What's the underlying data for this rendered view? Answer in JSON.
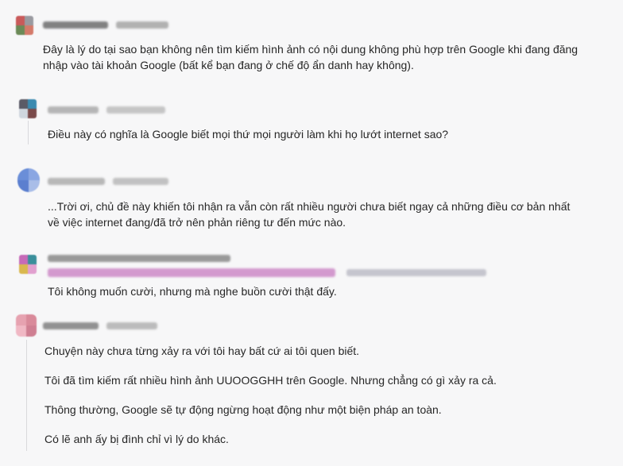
{
  "comments": [
    {
      "author": "",
      "time": "",
      "text": "Đây là lý do tại sao bạn không nên tìm kiếm hình ảnh có nội dung không phù hợp trên Google khi đang đăng nhập vào tài khoản Google (bất kể bạn đang ở chế độ ẩn danh hay không).",
      "avatar_colors": [
        "#c95a5a",
        "#9a9aa0",
        "#6b8a57",
        "#d47a6a"
      ]
    },
    {
      "author": "",
      "time": "",
      "text": "Điều này có nghĩa là Google biết mọi thứ mọi người làm khi họ lướt internet sao?",
      "avatar_colors": [
        "#5a5a66",
        "#3a8ab0",
        "#cfd6de",
        "#7a4a4a"
      ]
    },
    {
      "author": "",
      "time": "",
      "text": "...Trời ơi, chủ đề này khiến tôi nhận ra vẫn còn rất nhiều người chưa biết ngay cả những điều cơ bản nhất về việc internet đang/đã trở nên phản riêng tư đến mức nào.",
      "avatar_colors": [
        "#6a8ed8",
        "#8aa6e2",
        "#5b7fcf",
        "#a9bde8"
      ]
    },
    {
      "author": "",
      "time": "",
      "text": "Tôi không muốn cười, nhưng mà nghe buồn cười thật đấy.",
      "avatar_colors": [
        "#c66ab8",
        "#3a8f9b",
        "#d9b84e",
        "#e1a0cf"
      ]
    },
    {
      "author": "",
      "time": "",
      "paragraphs": [
        "Chuyện này chưa từng xảy ra với tôi hay bất cứ ai tôi quen biết.",
        "Tôi đã tìm kiếm rất nhiều hình ảnh UUOOGGHH trên Google. Nhưng chẳng có gì xảy ra cả.",
        "Thông thường, Google sẽ tự động ngừng hoạt động như một biện pháp an toàn.",
        "Có lẽ anh ấy bị đình chỉ vì lý do khác."
      ],
      "avatar_colors": [
        "#e6a2b0",
        "#d98a9a",
        "#f0b8c4",
        "#cf7f92"
      ]
    }
  ],
  "colors": {
    "background": "#f7f7f8",
    "thread_line": "#d9d9dc",
    "text": "#262626",
    "flair_bar": "#c77ac0"
  }
}
